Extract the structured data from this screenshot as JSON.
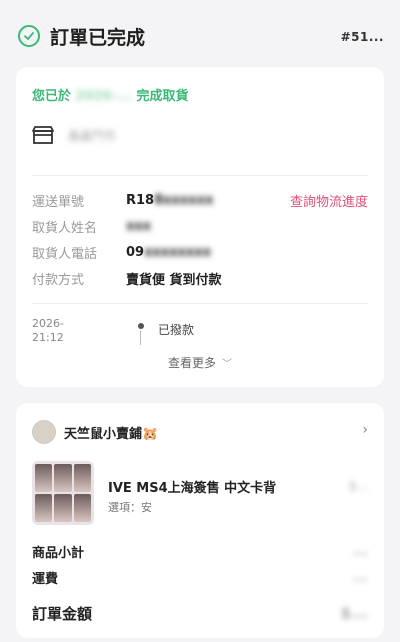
{
  "header": {
    "title": "訂單已完成",
    "order_id": "#51..."
  },
  "pickup": {
    "prefix": "您已於",
    "date": "2026-...",
    "suffix": "完成取貨",
    "store_name": "鑫鑫門市"
  },
  "info": {
    "tracking_label": "運送單號",
    "tracking_value": "R18",
    "tracking_blur": "8xxxxxx",
    "track_link": "查詢物流進度",
    "name_label": "取貨人姓名",
    "name_blur": "xxx",
    "phone_label": "取貨人電話",
    "phone_value": "09",
    "phone_blur": "xxxxxxxx",
    "payment_label": "付款方式",
    "payment_value": "賣貨便 貨到付款"
  },
  "timeline": {
    "date": "2026-",
    "time": "21:12",
    "status": "已撥款"
  },
  "see_more": "查看更多",
  "shop": {
    "name": "天竺鼠小賣鋪🐹"
  },
  "product": {
    "title": "IVE MS4上海簽售 中文卡背",
    "option": "選項：安",
    "price": "$..."
  },
  "summary": {
    "subtotal_label": "商品小計",
    "subtotal_value": "...",
    "shipping_label": "運費",
    "shipping_value": "...",
    "total_label": "訂單金額",
    "total_value": "$..."
  }
}
